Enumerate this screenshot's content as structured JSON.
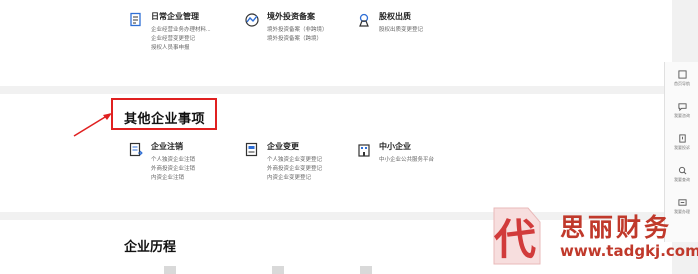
{
  "top_row": [
    {
      "title": "日常企业管理",
      "lines": [
        "企业经营业务办理材料...",
        "企业经营变更登记",
        "授权人员事申报"
      ],
      "icon": "document-icon"
    },
    {
      "title": "境外投资备案",
      "lines": [
        "境外投资备案（非跨境）",
        "境外投资备案（跨境）"
      ],
      "icon": "globe-icon"
    },
    {
      "title": "股权出质",
      "lines": [
        "股权出质变更登记"
      ],
      "icon": "stamp-icon"
    }
  ],
  "section": {
    "title": "其他企业事项"
  },
  "mid_row": [
    {
      "title": "企业注销",
      "lines": [
        "个人独资企业注销",
        "外商投资企业注销",
        "内资企业注销"
      ],
      "icon": "cancel-doc-icon"
    },
    {
      "title": "企业变更",
      "lines": [
        "个人独资企业变更登记",
        "外商投资企业变更登记",
        "内资企业变更登记"
      ],
      "icon": "edit-doc-icon"
    },
    {
      "title": "中小企业",
      "lines": [
        "中小企业公共服务平台"
      ],
      "icon": "building-icon"
    }
  ],
  "section2": {
    "title": "企业历程"
  },
  "sidebar": [
    {
      "label": "首页导航",
      "icon": "home-icon"
    },
    {
      "label": "我要咨询",
      "icon": "chat-icon"
    },
    {
      "label": "我要投诉",
      "icon": "complaint-icon"
    },
    {
      "label": "我要查询",
      "icon": "search-icon"
    },
    {
      "label": "我要办理",
      "icon": "form-icon"
    }
  ],
  "watermark": {
    "logo_char": "代",
    "name": "思丽财务",
    "url": "www.tadgkj.com"
  },
  "colors": {
    "accent_blue": "#2f6fd6",
    "highlight_red": "#e02020",
    "watermark_red": "#c0392b"
  }
}
